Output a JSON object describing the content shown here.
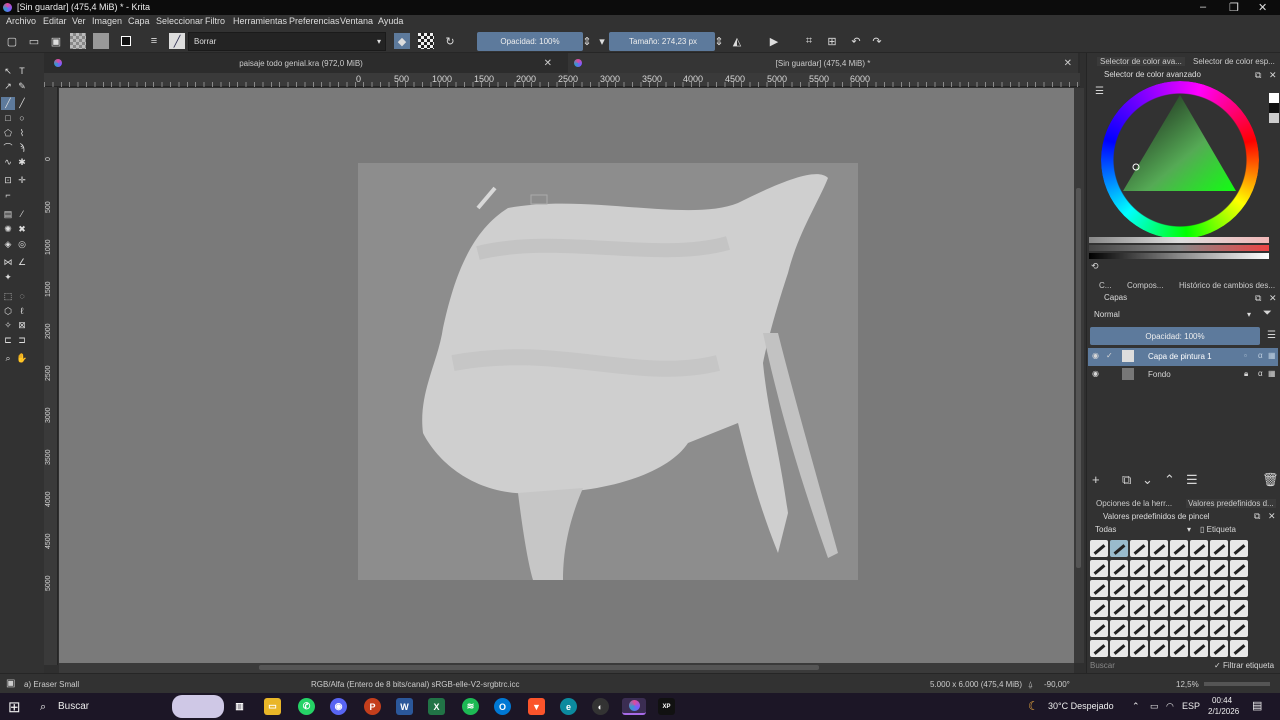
{
  "window": {
    "title": "[Sin guardar]  (475,4 MiB) * - Krita",
    "min": "–",
    "max": "❐",
    "close": "✕"
  },
  "menu": [
    "Archivo",
    "Editar",
    "Ver",
    "Imagen",
    "Capa",
    "Seleccionar",
    "Filtro",
    "Herramientas",
    "Preferencias",
    "Ventana",
    "Ayuda"
  ],
  "toolbar": {
    "blend_mode": "Borrar",
    "opacity": "Opacidad: 100%",
    "size": "Tamaño: 274,23 px"
  },
  "doc_tabs": [
    {
      "label": "paisaje todo genial.kra (972,0 MiB)",
      "close": "✕"
    },
    {
      "label": "[Sin guardar]  (475,4 MiB) *",
      "close": "✕"
    }
  ],
  "ruler_h": [
    "0",
    "500",
    "1000",
    "1500",
    "2000",
    "2500",
    "3000",
    "3500",
    "4000",
    "4500",
    "5000",
    "5500",
    "6000"
  ],
  "ruler_v": [
    "0",
    "500",
    "1000",
    "1500",
    "2000",
    "2500",
    "3000",
    "3500",
    "4000",
    "4500",
    "5000"
  ],
  "dock": {
    "top_tabs": [
      "Selector de color ava...",
      "Selector de color esp..."
    ],
    "color_header": "Selector de color avanzado",
    "mid_tabs": [
      "C...",
      "Compos...",
      "Histórico de cambios des..."
    ],
    "layers_header": "Capas",
    "blend": "Normal",
    "opacity": "Opacidad:  100%",
    "layers": [
      {
        "name": "Capa de pintura 1",
        "selected": true
      },
      {
        "name": "Fondo",
        "selected": false
      }
    ],
    "bottom_tabs": [
      "Opciones de la herr...",
      "Valores predefinidos d..."
    ],
    "presets_header": "Valores predefinidos de pincel",
    "filter_all": "Todas",
    "tag": "Etiqueta",
    "search_placeholder": "Buscar",
    "filter_tag": "Filtrar etiqueta"
  },
  "status": {
    "preset": "a) Eraser Small",
    "color_model": "RGB/Alfa (Entero de 8 bits/canal)  sRGB-elle-V2-srgbtrc.icc",
    "dims": "5.000 x 6.000 (475,4 MiB)",
    "rotation": "-90,00°",
    "zoom": "12,5%"
  },
  "taskbar": {
    "search": "Buscar",
    "weather": "30°C  Despejado",
    "lang": "ESP",
    "time": "00:44",
    "date": "2/1/2026"
  },
  "colors": {
    "accent": "#5d7a9c",
    "canvas_bg": "#7a7a7a",
    "paper": "#8d8d8d",
    "stroke": "#cfcfcf"
  }
}
